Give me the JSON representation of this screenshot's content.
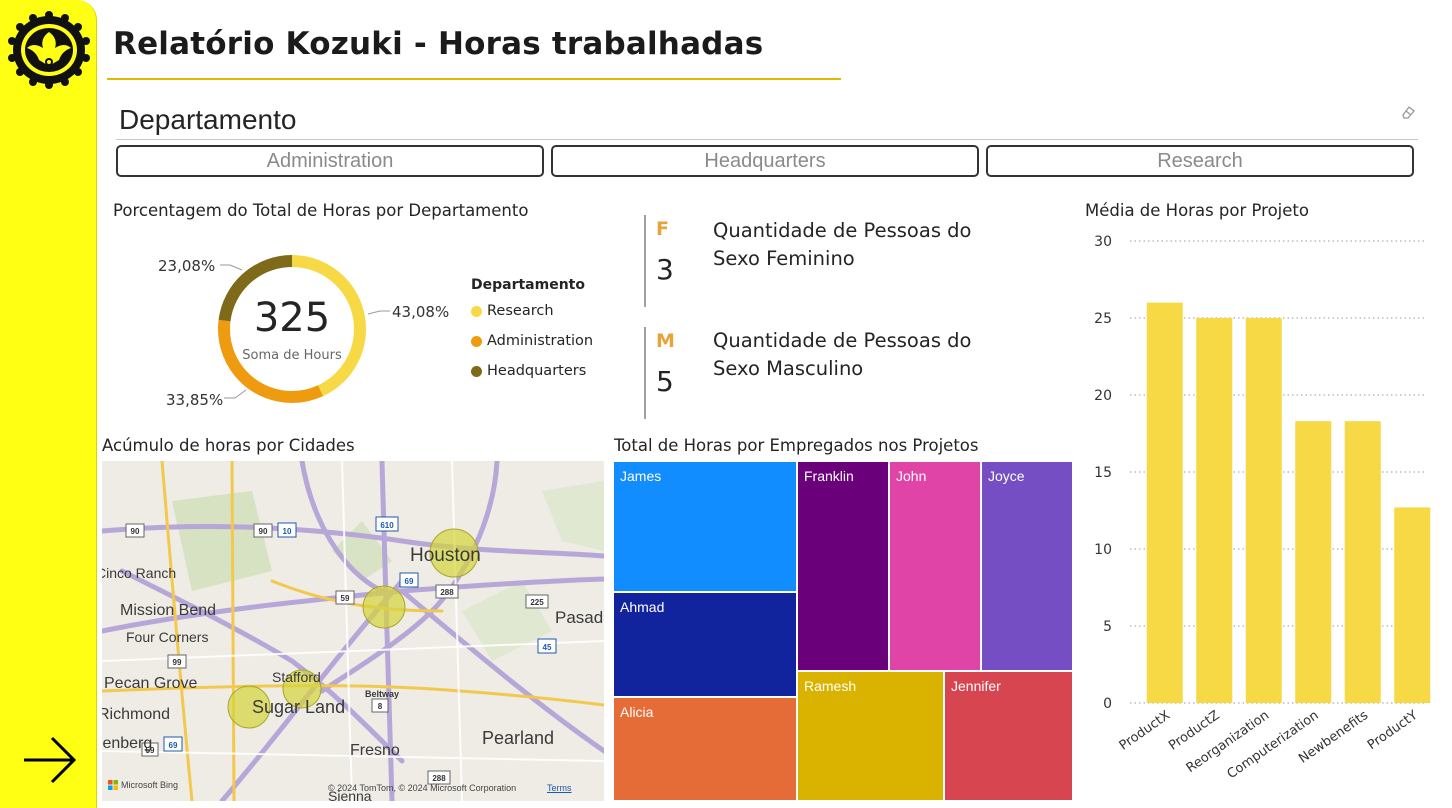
{
  "header": {
    "title": "Relatório Kozuki - Horas trabalhadas"
  },
  "slicer": {
    "title": "Departamento",
    "options": [
      "Administration",
      "Headquarters",
      "Research"
    ]
  },
  "donut": {
    "title": "Porcentagem do Total de Horas por Departamento",
    "center_value": "325",
    "center_label": "Soma de Hours",
    "slices": [
      {
        "name": "Research",
        "percent": 43.08,
        "label": "43,08%",
        "color": "#f6d944"
      },
      {
        "name": "Administration",
        "percent": 33.85,
        "label": "33,85%",
        "color": "#ef9b0f"
      },
      {
        "name": "Headquarters",
        "percent": 23.08,
        "label": "23,08%",
        "color": "#7f6a19"
      }
    ],
    "legend": {
      "title": "Departamento",
      "items": [
        "Research",
        "Administration",
        "Headquarters"
      ]
    }
  },
  "cards": [
    {
      "letter": "F",
      "value": "3",
      "label": "Quantidade de Pessoas do Sexo Feminino"
    },
    {
      "letter": "M",
      "value": "5",
      "label": "Quantidade de Pessoas do Sexo Masculino"
    }
  ],
  "map": {
    "title": "Acúmulo de horas por Cidades",
    "labels": [
      "Houston",
      "Sugar Land",
      "Stafford",
      "Pearland",
      "Fresno",
      "Pasadena",
      "Mission Bend",
      "Four Corners",
      "Pecan Grove",
      "Richmond",
      "Rosenberg",
      "Cinco Ranch",
      "Sienna",
      "Beltway"
    ],
    "credits": {
      "bing": "Microsoft Bing",
      "copyright": "© 2024 TomTom, © 2024 Microsoft Corporation",
      "terms": "Terms"
    }
  },
  "treemap": {
    "title": "Total de Horas por Empregados nos Projetos",
    "items": [
      {
        "name": "James",
        "color": "#118dff"
      },
      {
        "name": "Ahmad",
        "color": "#12239e"
      },
      {
        "name": "Alicia",
        "color": "#e66c37"
      },
      {
        "name": "Franklin",
        "color": "#6b007b"
      },
      {
        "name": "John",
        "color": "#e044a7"
      },
      {
        "name": "Joyce",
        "color": "#744ec2"
      },
      {
        "name": "Ramesh",
        "color": "#d9b300"
      },
      {
        "name": "Jennifer",
        "color": "#d64550"
      }
    ]
  },
  "chart_data": {
    "type": "bar",
    "title": "Média de Horas por Projeto",
    "categories": [
      "ProductX",
      "ProductZ",
      "Reorganization",
      "Computerization",
      "Newbenefits",
      "ProductY"
    ],
    "values": [
      26,
      25,
      25,
      18.3,
      18.3,
      12.7
    ],
    "ylim": [
      0,
      30
    ],
    "yticks": [
      0,
      5,
      10,
      15,
      20,
      25,
      30
    ],
    "color": "#f6d944",
    "grid": true
  }
}
